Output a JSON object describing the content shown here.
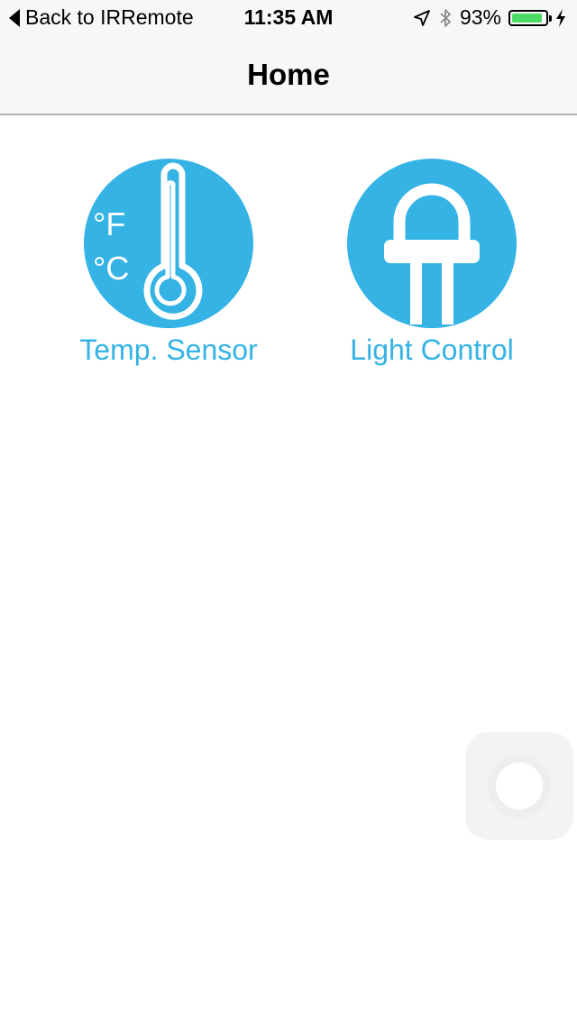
{
  "status_bar": {
    "back_label": "Back to IRRemote",
    "time": "11:35 AM",
    "battery_text": "93%",
    "battery_level": 0.93,
    "icons": [
      "location-icon",
      "bluetooth-icon",
      "battery-icon",
      "charging-bolt-icon"
    ]
  },
  "nav": {
    "title": "Home"
  },
  "tiles": [
    {
      "label": "Temp. Sensor",
      "icon": "thermometer-icon",
      "units": [
        "°F",
        "°C"
      ]
    },
    {
      "label": "Light Control",
      "icon": "led-bulb-icon"
    }
  ],
  "colors": {
    "accent": "#34b3e4",
    "nav_bg": "#f7f7f7",
    "battery_fill": "#4cd964",
    "background": "#ffffff"
  }
}
